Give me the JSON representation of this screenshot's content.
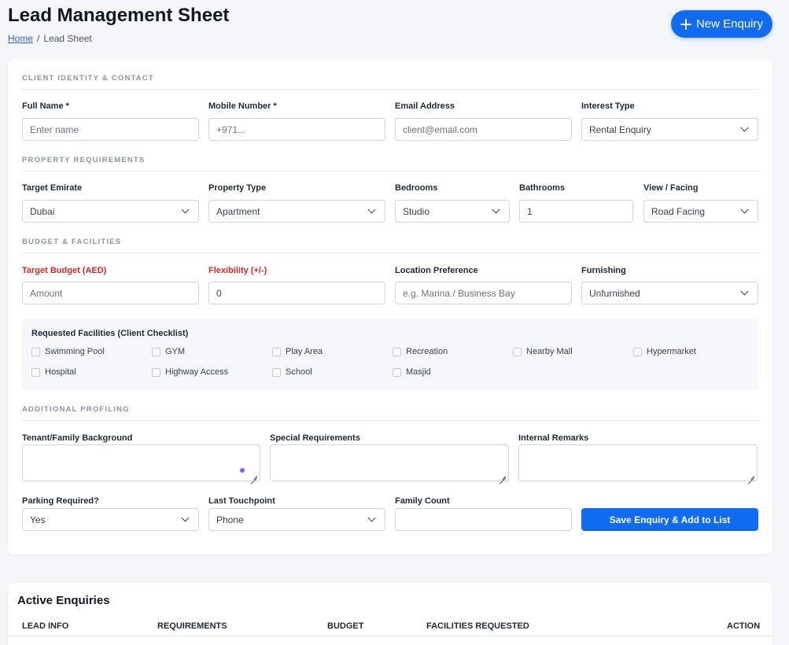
{
  "header": {
    "title": "Lead Management Sheet",
    "breadcrumb_home": "Home",
    "breadcrumb_sep": "/",
    "breadcrumb_current": "Lead Sheet",
    "new_enquiry_label": "New Enquiry"
  },
  "sections": {
    "client": "CLIENT IDENTITY & CONTACT",
    "property": "PROPERTY REQUIREMENTS",
    "budget": "BUDGET & FACILITIES",
    "profiling": "ADDITIONAL PROFILING"
  },
  "client": {
    "full_name_label": "Full Name *",
    "full_name_placeholder": "Enter name",
    "mobile_label": "Mobile Number *",
    "mobile_placeholder": "+971...",
    "email_label": "Email Address",
    "email_placeholder": "client@email.com",
    "interest_label": "Interest Type",
    "interest_value": "Rental Enquiry"
  },
  "property": {
    "emirate_label": "Target Emirate",
    "emirate_value": "Dubai",
    "type_label": "Property Type",
    "type_value": "Apartment",
    "bedrooms_label": "Bedrooms",
    "bedrooms_value": "Studio",
    "bathrooms_label": "Bathrooms",
    "bathrooms_value": "1",
    "view_label": "View / Facing",
    "view_value": "Road Facing"
  },
  "budget": {
    "target_label": "Target Budget (AED)",
    "target_placeholder": "Amount",
    "flex_label": "Flexibility (+/-)",
    "flex_value": "0",
    "location_label": "Location Preference",
    "location_placeholder": "e.g. Marina / Business Bay",
    "furnishing_label": "Furnishing",
    "furnishing_value": "Unfurnished"
  },
  "facilities": {
    "title": "Requested Facilities (Client Checklist)",
    "items": [
      "Swimming Pool",
      "GYM",
      "Play Area",
      "Recreation",
      "Nearby Mall",
      "Hypermarket",
      "Hospital",
      "Highway Access",
      "School",
      "Masjid"
    ]
  },
  "profiling": {
    "background_label": "Tenant/Family Background",
    "special_label": "Special Requirements",
    "remarks_label": "Internal Remarks",
    "parking_label": "Parking Required?",
    "parking_value": "Yes",
    "touchpoint_label": "Last Touchpoint",
    "touchpoint_value": "Phone",
    "family_label": "Family Count",
    "save_label": "Save Enquiry & Add to List"
  },
  "table": {
    "title": "Active Enquiries",
    "columns": [
      "LEAD INFO",
      "REQUIREMENTS",
      "BUDGET",
      "FACILITIES REQUESTED",
      "ACTION"
    ]
  },
  "colors": {
    "primary": "#0f6cf2",
    "danger_label": "#dc2626",
    "accent_dot": "#8b5cf6"
  }
}
